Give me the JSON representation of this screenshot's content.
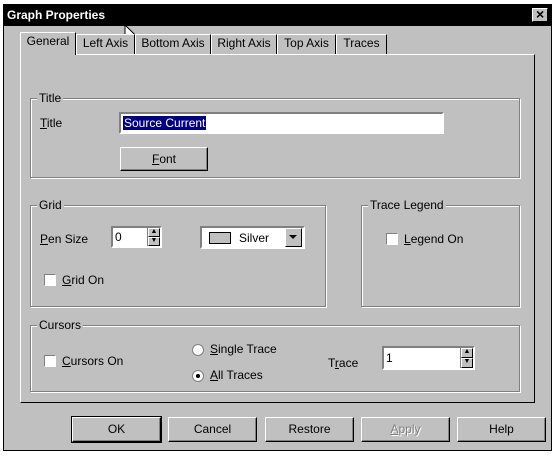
{
  "window": {
    "title": "Graph Properties",
    "close_glyph": "×"
  },
  "tabs": [
    {
      "label": "General",
      "active": true
    },
    {
      "label": "Left Axis"
    },
    {
      "label": "Bottom Axis"
    },
    {
      "label": "Right Axis"
    },
    {
      "label": "Top Axis"
    },
    {
      "label": "Traces"
    }
  ],
  "title_group": {
    "legend": "Title",
    "title_label_accel": "T",
    "title_label_rest": "itle",
    "title_value": "Source Current",
    "font_button_accel": "F",
    "font_button_rest": "ont"
  },
  "grid_group": {
    "legend": "Grid",
    "pen_size_accel": "P",
    "pen_size_rest": "en Size",
    "pen_size_value": "0",
    "color_value": "Silver",
    "swatch_color": "#c0c0c0",
    "grid_on_accel": "G",
    "grid_on_rest": "rid On",
    "grid_on_checked": false
  },
  "legend_group": {
    "legend": "Trace Legend",
    "legend_on_accel": "L",
    "legend_on_rest": "egend On",
    "legend_on_checked": false
  },
  "cursors_group": {
    "legend": "Cursors",
    "cursors_on_accel": "C",
    "cursors_on_rest": "ursors On",
    "single_trace_accel": "S",
    "single_trace_rest": "ingle Trace",
    "all_traces_accel": "A",
    "all_traces_rest": "ll Traces",
    "selected_mode": "all_traces",
    "trace_label_pre": "T",
    "trace_label_accel": "r",
    "trace_label_post": "ace",
    "trace_value": "1"
  },
  "buttons": {
    "ok": "OK",
    "cancel": "Cancel",
    "restore": "Restore",
    "apply_accel": "A",
    "apply_rest": "pply",
    "help": "Help"
  }
}
